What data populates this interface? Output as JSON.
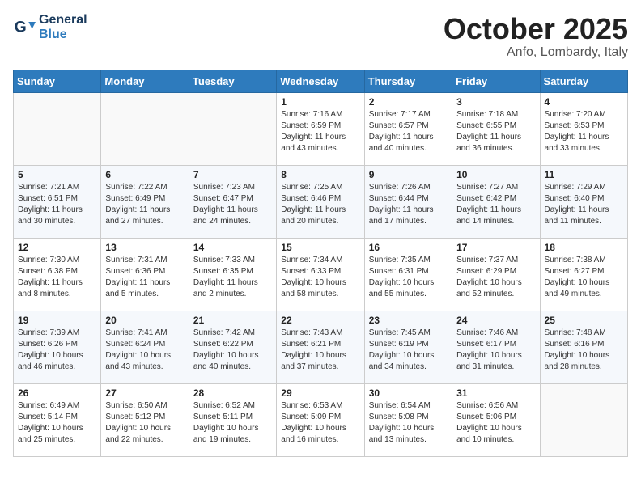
{
  "header": {
    "logo_line1": "General",
    "logo_line2": "Blue",
    "month": "October 2025",
    "location": "Anfo, Lombardy, Italy"
  },
  "days_of_week": [
    "Sunday",
    "Monday",
    "Tuesday",
    "Wednesday",
    "Thursday",
    "Friday",
    "Saturday"
  ],
  "weeks": [
    [
      {
        "day": "",
        "info": ""
      },
      {
        "day": "",
        "info": ""
      },
      {
        "day": "",
        "info": ""
      },
      {
        "day": "1",
        "info": "Sunrise: 7:16 AM\nSunset: 6:59 PM\nDaylight: 11 hours\nand 43 minutes."
      },
      {
        "day": "2",
        "info": "Sunrise: 7:17 AM\nSunset: 6:57 PM\nDaylight: 11 hours\nand 40 minutes."
      },
      {
        "day": "3",
        "info": "Sunrise: 7:18 AM\nSunset: 6:55 PM\nDaylight: 11 hours\nand 36 minutes."
      },
      {
        "day": "4",
        "info": "Sunrise: 7:20 AM\nSunset: 6:53 PM\nDaylight: 11 hours\nand 33 minutes."
      }
    ],
    [
      {
        "day": "5",
        "info": "Sunrise: 7:21 AM\nSunset: 6:51 PM\nDaylight: 11 hours\nand 30 minutes."
      },
      {
        "day": "6",
        "info": "Sunrise: 7:22 AM\nSunset: 6:49 PM\nDaylight: 11 hours\nand 27 minutes."
      },
      {
        "day": "7",
        "info": "Sunrise: 7:23 AM\nSunset: 6:47 PM\nDaylight: 11 hours\nand 24 minutes."
      },
      {
        "day": "8",
        "info": "Sunrise: 7:25 AM\nSunset: 6:46 PM\nDaylight: 11 hours\nand 20 minutes."
      },
      {
        "day": "9",
        "info": "Sunrise: 7:26 AM\nSunset: 6:44 PM\nDaylight: 11 hours\nand 17 minutes."
      },
      {
        "day": "10",
        "info": "Sunrise: 7:27 AM\nSunset: 6:42 PM\nDaylight: 11 hours\nand 14 minutes."
      },
      {
        "day": "11",
        "info": "Sunrise: 7:29 AM\nSunset: 6:40 PM\nDaylight: 11 hours\nand 11 minutes."
      }
    ],
    [
      {
        "day": "12",
        "info": "Sunrise: 7:30 AM\nSunset: 6:38 PM\nDaylight: 11 hours\nand 8 minutes."
      },
      {
        "day": "13",
        "info": "Sunrise: 7:31 AM\nSunset: 6:36 PM\nDaylight: 11 hours\nand 5 minutes."
      },
      {
        "day": "14",
        "info": "Sunrise: 7:33 AM\nSunset: 6:35 PM\nDaylight: 11 hours\nand 2 minutes."
      },
      {
        "day": "15",
        "info": "Sunrise: 7:34 AM\nSunset: 6:33 PM\nDaylight: 10 hours\nand 58 minutes."
      },
      {
        "day": "16",
        "info": "Sunrise: 7:35 AM\nSunset: 6:31 PM\nDaylight: 10 hours\nand 55 minutes."
      },
      {
        "day": "17",
        "info": "Sunrise: 7:37 AM\nSunset: 6:29 PM\nDaylight: 10 hours\nand 52 minutes."
      },
      {
        "day": "18",
        "info": "Sunrise: 7:38 AM\nSunset: 6:27 PM\nDaylight: 10 hours\nand 49 minutes."
      }
    ],
    [
      {
        "day": "19",
        "info": "Sunrise: 7:39 AM\nSunset: 6:26 PM\nDaylight: 10 hours\nand 46 minutes."
      },
      {
        "day": "20",
        "info": "Sunrise: 7:41 AM\nSunset: 6:24 PM\nDaylight: 10 hours\nand 43 minutes."
      },
      {
        "day": "21",
        "info": "Sunrise: 7:42 AM\nSunset: 6:22 PM\nDaylight: 10 hours\nand 40 minutes."
      },
      {
        "day": "22",
        "info": "Sunrise: 7:43 AM\nSunset: 6:21 PM\nDaylight: 10 hours\nand 37 minutes."
      },
      {
        "day": "23",
        "info": "Sunrise: 7:45 AM\nSunset: 6:19 PM\nDaylight: 10 hours\nand 34 minutes."
      },
      {
        "day": "24",
        "info": "Sunrise: 7:46 AM\nSunset: 6:17 PM\nDaylight: 10 hours\nand 31 minutes."
      },
      {
        "day": "25",
        "info": "Sunrise: 7:48 AM\nSunset: 6:16 PM\nDaylight: 10 hours\nand 28 minutes."
      }
    ],
    [
      {
        "day": "26",
        "info": "Sunrise: 6:49 AM\nSunset: 5:14 PM\nDaylight: 10 hours\nand 25 minutes."
      },
      {
        "day": "27",
        "info": "Sunrise: 6:50 AM\nSunset: 5:12 PM\nDaylight: 10 hours\nand 22 minutes."
      },
      {
        "day": "28",
        "info": "Sunrise: 6:52 AM\nSunset: 5:11 PM\nDaylight: 10 hours\nand 19 minutes."
      },
      {
        "day": "29",
        "info": "Sunrise: 6:53 AM\nSunset: 5:09 PM\nDaylight: 10 hours\nand 16 minutes."
      },
      {
        "day": "30",
        "info": "Sunrise: 6:54 AM\nSunset: 5:08 PM\nDaylight: 10 hours\nand 13 minutes."
      },
      {
        "day": "31",
        "info": "Sunrise: 6:56 AM\nSunset: 5:06 PM\nDaylight: 10 hours\nand 10 minutes."
      },
      {
        "day": "",
        "info": ""
      }
    ]
  ]
}
